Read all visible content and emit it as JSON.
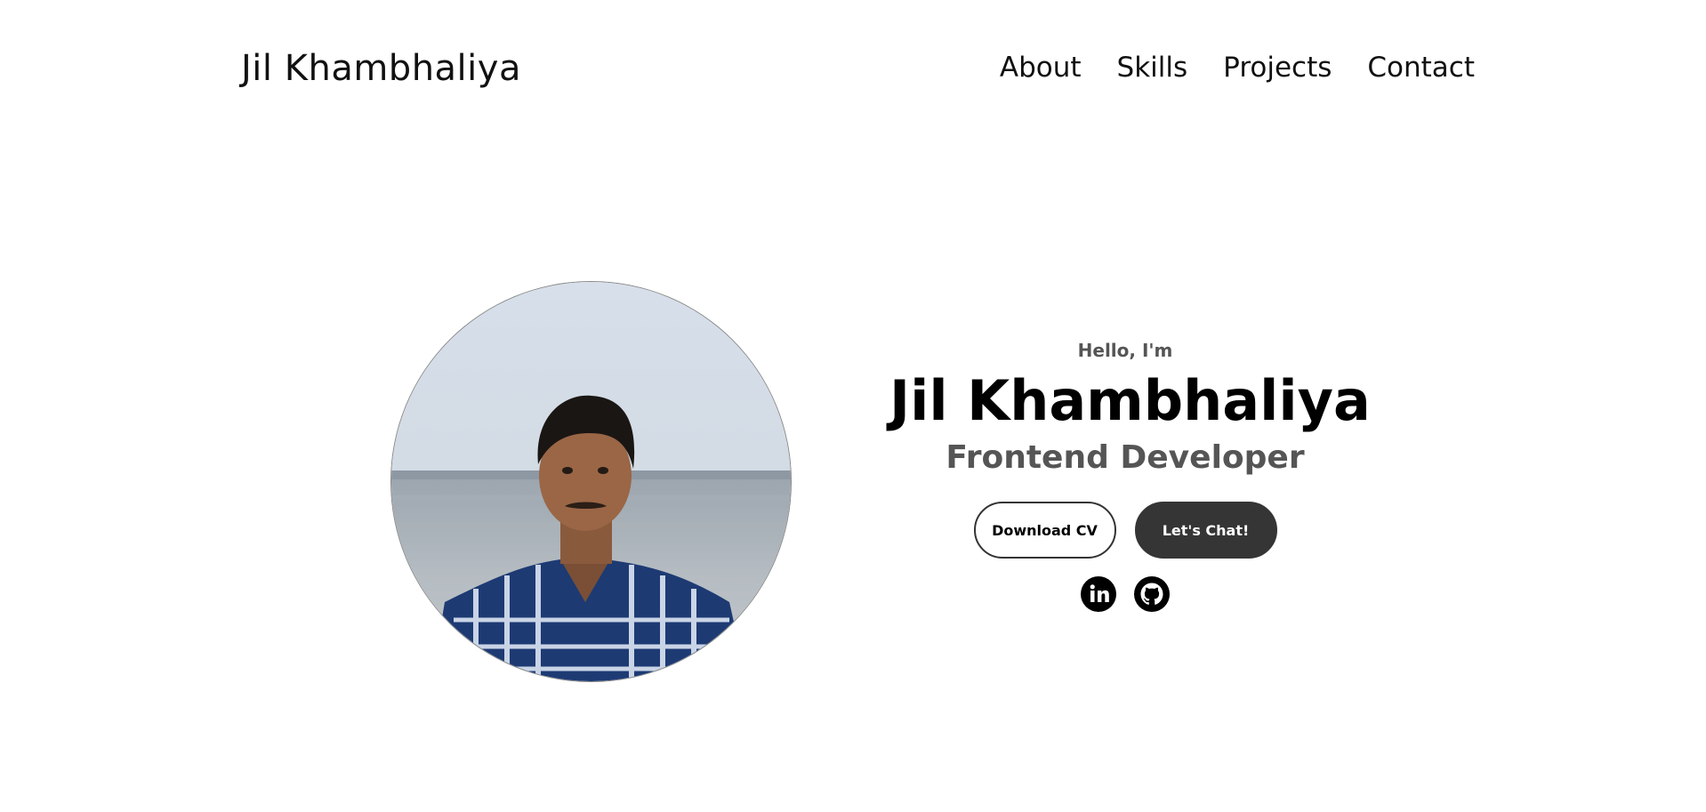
{
  "header": {
    "logo": "Jil Khambhaliya",
    "nav": [
      "About",
      "Skills",
      "Projects",
      "Contact"
    ]
  },
  "profile": {
    "greeting": "Hello, I'm",
    "name": "Jil Khambhaliya",
    "title": "Frontend Developer",
    "buttons": {
      "download": "Download CV",
      "chat": "Let's Chat!"
    },
    "socials": [
      "linkedin-icon",
      "github-icon"
    ]
  },
  "colors": {
    "text": "#000000",
    "muted": "#555555",
    "button_dark": "#353535",
    "background": "#ffffff"
  }
}
